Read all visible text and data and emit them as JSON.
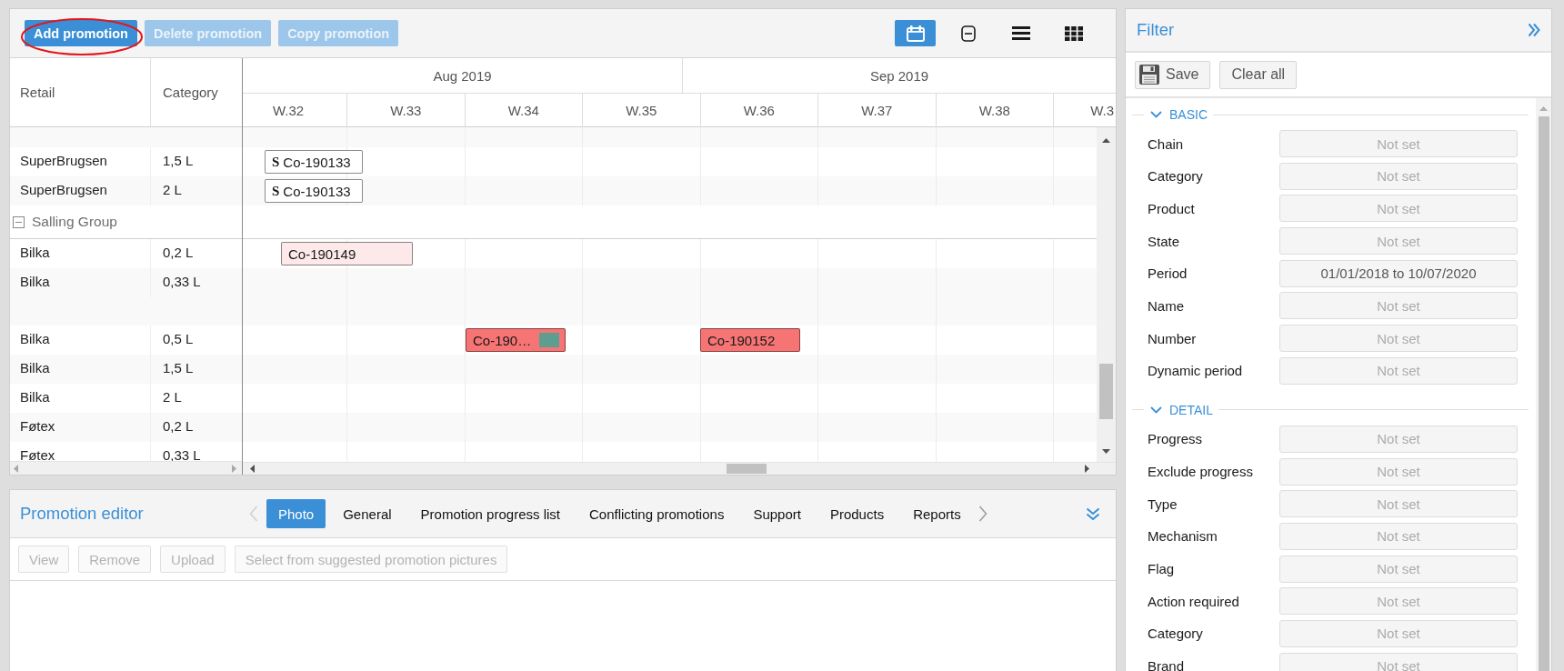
{
  "planner": {
    "toolbar_buttons": [
      {
        "label": "Add promotion",
        "disabled": false,
        "circled": true
      },
      {
        "label": "Delete promotion",
        "disabled": true,
        "circled": false
      },
      {
        "label": "Copy promotion",
        "disabled": true,
        "circled": false
      }
    ],
    "view_buttons": [
      {
        "kind": "calendar",
        "selected": true
      },
      {
        "kind": "collapse",
        "selected": false
      },
      {
        "kind": "list",
        "selected": false
      },
      {
        "kind": "grid",
        "selected": false
      }
    ],
    "columns": [
      {
        "label": "Retail"
      },
      {
        "label": "Category"
      }
    ],
    "months": [
      {
        "label": "Aug 2019"
      },
      {
        "label": "Sep 2019"
      }
    ],
    "weeks": [
      {
        "label": "W.32"
      },
      {
        "label": "W.33"
      },
      {
        "label": "W.34"
      },
      {
        "label": "W.35"
      },
      {
        "label": "W.36"
      },
      {
        "label": "W.37"
      },
      {
        "label": "W.38"
      },
      {
        "label": "W.3"
      }
    ],
    "rows": [
      {
        "kind": "item",
        "retail": "SuperBrugsen",
        "category": "1,5 L",
        "promotions": [
          {
            "flag": "S",
            "label": "Co-190133",
            "color": "#ffffff"
          }
        ]
      },
      {
        "kind": "item",
        "retail": "SuperBrugsen",
        "category": "2 L",
        "promotions": [
          {
            "flag": "S",
            "label": "Co-190133",
            "color": "#ffffff"
          }
        ]
      },
      {
        "kind": "group",
        "label": "Salling Group",
        "expanded": true,
        "children": [
          {
            "kind": "item",
            "retail": "Bilka",
            "category": "0,2 L",
            "promotions": [
              {
                "label": "Co-190149",
                "color": "#fde9e9"
              }
            ]
          },
          {
            "kind": "item",
            "retail": "Bilka",
            "category": "0,33 L"
          },
          {
            "kind": "item",
            "retail": "Bilka",
            "category": "0,5 L",
            "promotions": [
              {
                "label": "Co-190…",
                "color": "#f67474",
                "tag": {
                  "color": "#5e9e90"
                }
              },
              {
                "label": "Co-190152",
                "color": "#f67474"
              }
            ]
          },
          {
            "kind": "item",
            "retail": "Bilka",
            "category": "1,5 L"
          },
          {
            "kind": "item",
            "retail": "Bilka",
            "category": "2 L"
          },
          {
            "kind": "item",
            "retail": "Føtex",
            "category": "0,2 L"
          },
          {
            "kind": "item",
            "retail": "Føtex",
            "category": "0,33 L"
          }
        ]
      }
    ]
  },
  "editor": {
    "title": "Promotion editor",
    "prev": {
      "disabled": true
    },
    "next": {
      "disabled": false
    },
    "tabs": [
      {
        "label": "Photo",
        "selected": true
      },
      {
        "label": "General",
        "selected": false
      },
      {
        "label": "Promotion progress list",
        "selected": false
      },
      {
        "label": "Conflicting promotions",
        "selected": false
      },
      {
        "label": "Support",
        "selected": false
      },
      {
        "label": "Products",
        "selected": false
      },
      {
        "label": "Reports",
        "selected": false
      }
    ],
    "buttons": [
      {
        "label": "View",
        "disabled": true
      },
      {
        "label": "Remove",
        "disabled": true
      },
      {
        "label": "Upload",
        "disabled": true
      },
      {
        "label": "Select from suggested promotion pictures",
        "disabled": true
      }
    ]
  },
  "filter": {
    "title": "Filter",
    "buttons": [
      {
        "kind": "save",
        "label": "Save"
      },
      {
        "kind": "clear",
        "label": "Clear all"
      }
    ],
    "sections": [
      {
        "title": "BASIC",
        "expanded": true,
        "fields": [
          {
            "label": "Chain",
            "placeholder": "Not set"
          },
          {
            "label": "Category",
            "placeholder": "Not set"
          },
          {
            "label": "Product",
            "placeholder": "Not set"
          },
          {
            "label": "State",
            "placeholder": "Not set"
          },
          {
            "label": "Period",
            "value": "01/01/2018 to 10/07/2020"
          },
          {
            "label": "Name",
            "placeholder": "Not set"
          },
          {
            "label": "Number",
            "placeholder": "Not set"
          },
          {
            "label": "Dynamic period",
            "placeholder": "Not set"
          }
        ]
      },
      {
        "title": "DETAIL",
        "expanded": true,
        "fields": [
          {
            "label": "Progress",
            "placeholder": "Not set"
          },
          {
            "label": "Exclude progress",
            "placeholder": "Not set"
          },
          {
            "label": "Type",
            "placeholder": "Not set"
          },
          {
            "label": "Mechanism",
            "placeholder": "Not set"
          },
          {
            "label": "Flag",
            "placeholder": "Not set"
          },
          {
            "label": "Action required",
            "placeholder": "Not set"
          },
          {
            "label": "Category",
            "placeholder": "Not set"
          },
          {
            "label": "Brand",
            "placeholder": "Not set"
          }
        ]
      }
    ]
  }
}
